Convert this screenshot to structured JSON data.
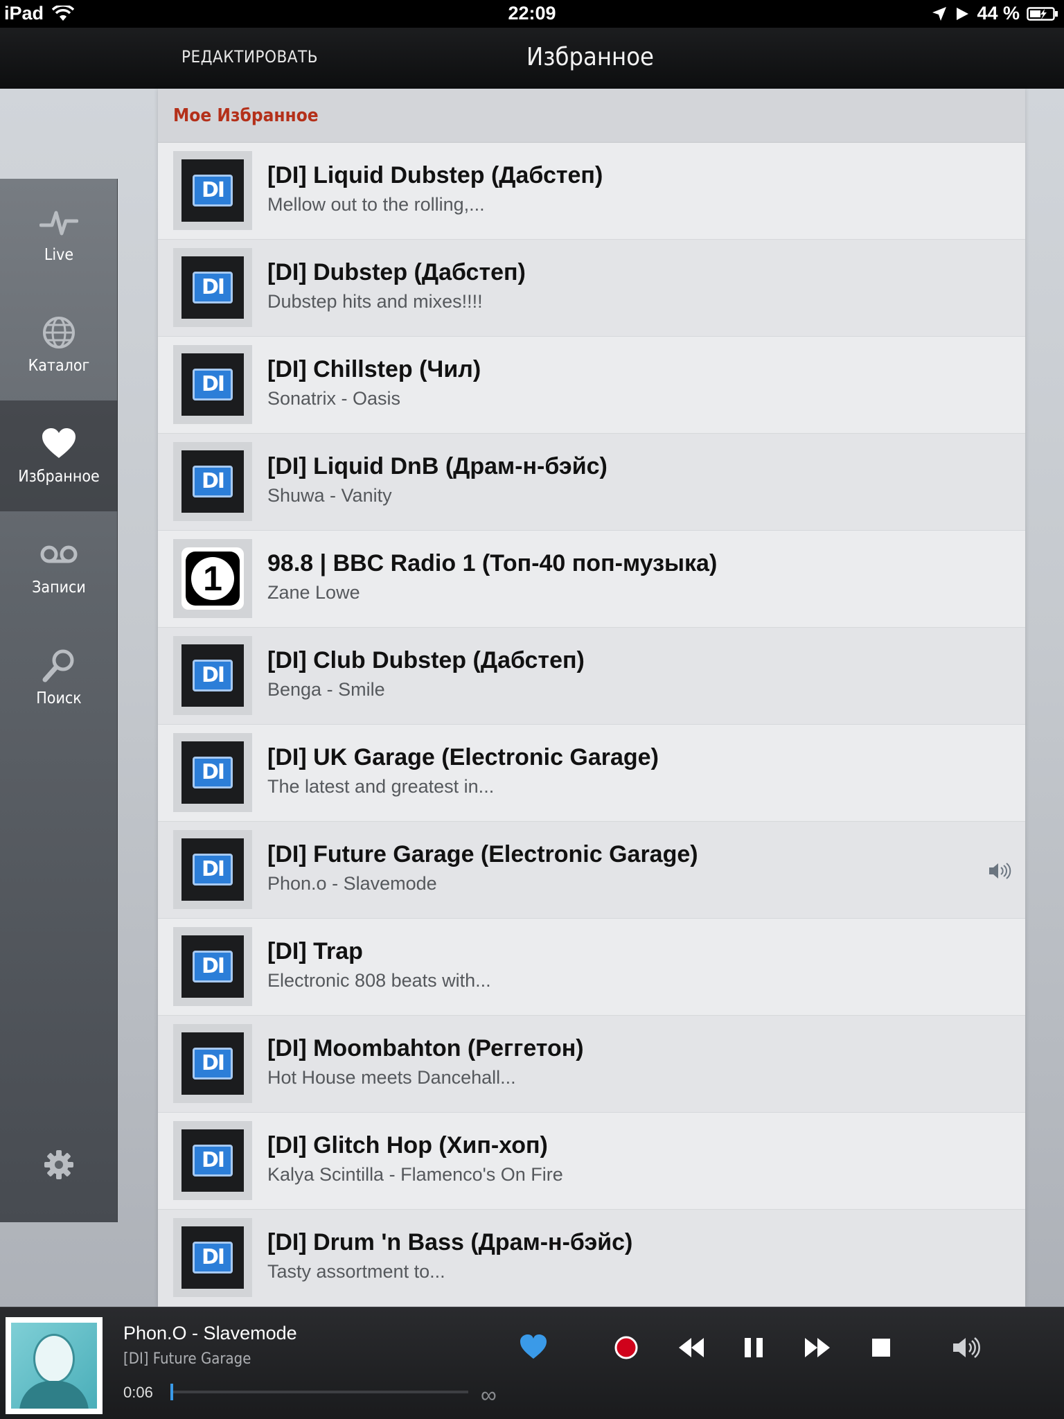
{
  "status": {
    "device": "iPad",
    "time": "22:09",
    "battery": "44 %"
  },
  "nav": {
    "edit_label": "РЕДАКТИРОВАТЬ",
    "title": "Избранное"
  },
  "sidebar": {
    "items": [
      {
        "label": "Live",
        "icon": "live-wave-icon"
      },
      {
        "label": "Каталог",
        "icon": "globe-icon"
      },
      {
        "label": "Избранное",
        "icon": "heart-icon",
        "active": true
      },
      {
        "label": "Записи",
        "icon": "voicemail-icon"
      },
      {
        "label": "Поиск",
        "icon": "magnifier-icon"
      }
    ],
    "settings_icon": "gear-icon"
  },
  "list": {
    "header": "Мое Избранное",
    "rows": [
      {
        "name": "[DI] Liquid Dubstep (Дабстеп)",
        "sub": "Mellow out to the rolling,..."
      },
      {
        "name": "[DI] Dubstep (Дабстеп)",
        "sub": "Dubstep hits and mixes!!!!"
      },
      {
        "name": "[DI] Chillstep (Чил)",
        "sub": "Sonatrix - Oasis"
      },
      {
        "name": "[DI] Liquid DnB (Драм-н-бэйс)",
        "sub": "Shuwa - Vanity"
      },
      {
        "name": "98.8 | BBC Radio 1 (Топ-40 поп-музыка)",
        "sub": "Zane Lowe"
      },
      {
        "name": "[DI] Club Dubstep (Дабстеп)",
        "sub": "Benga - Smile"
      },
      {
        "name": "[DI] UK Garage (Electronic Garage)",
        "sub": "The latest and greatest in..."
      },
      {
        "name": "[DI] Future Garage (Electronic Garage)",
        "sub": "Phon.o - Slavemode"
      },
      {
        "name": "[DI] Trap",
        "sub": "Electronic 808 beats with..."
      },
      {
        "name": "[DI] Moombahton (Реггетон)",
        "sub": "Hot House meets Dancehall..."
      },
      {
        "name": "[DI] Glitch Hop (Хип-хоп)",
        "sub": "Kalya Scintilla - Flamenco's On Fire"
      },
      {
        "name": "[DI] Drum 'n Bass (Драм-н-бэйс)",
        "sub": "Tasty assortment to..."
      }
    ]
  },
  "player": {
    "track": "Phon.O - Slavemode",
    "station": "[DI] Future Garage",
    "elapsed": "0:06",
    "duration_symbol": "∞",
    "accent": "#3a9ae8",
    "record_color": "#d0021b"
  }
}
